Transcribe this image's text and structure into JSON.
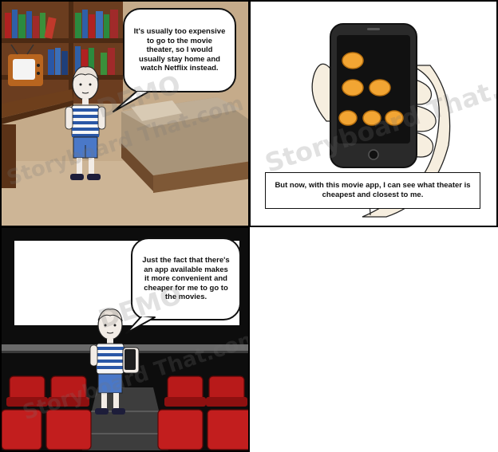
{
  "panels": [
    {
      "speech": "It's usually too expensive to go to the movie theater, so I would usually stay home and watch Netflix instead.",
      "watermark_a": "DEMO",
      "watermark_b": "Storyboard That.com"
    },
    {
      "caption": "But now, with this movie app, I can see what theater is cheapest and closest to me.",
      "watermark_a": "Storyboard That.com"
    },
    {
      "speech": "Just the fact that there's an app available makes it more convenient and cheaper for me to go to the movies.",
      "watermark_a": "DEMO",
      "watermark_b": "Storyboard That.com"
    }
  ],
  "colors": {
    "wall": "#c5ab8a",
    "shelf_wood": "#6b3d1f",
    "bed_frame": "#6e4a2c",
    "shirt_stripe_blue": "#2a57a6",
    "shorts": "#4a78c8",
    "seat_red": "#b81a1a",
    "coin_orange": "#f2a533",
    "phone_black": "#1e1e1e"
  }
}
